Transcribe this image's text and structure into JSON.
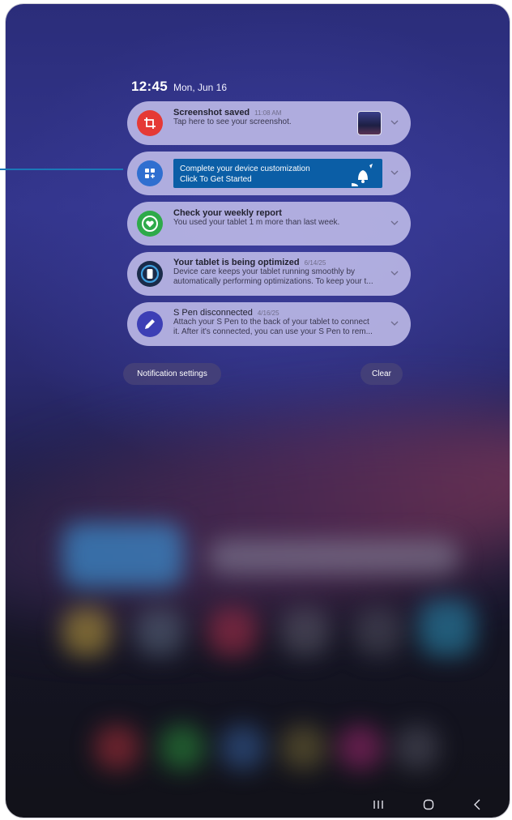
{
  "status": {
    "time": "12:45",
    "date": "Mon, Jun 16"
  },
  "notifications": [
    {
      "id": "screenshot",
      "title": "Screenshot saved",
      "time": "11:08 AM",
      "text": "Tap here to see your screenshot.",
      "icon": "screenshot-crop-icon",
      "icon_color": "#e53935"
    },
    {
      "id": "customization",
      "banner_line1": "Complete your device customization",
      "banner_line2": "Click To Get Started",
      "icon": "apps-add-icon",
      "icon_color": "#2f6fd0",
      "banner_color": "#0b5ea6"
    },
    {
      "id": "weekly",
      "title": "Check your weekly report",
      "time": "",
      "text": "You used your tablet 1 m more than last week.",
      "icon": "digital-wellbeing-heart-icon",
      "icon_color": "#2eaa4a"
    },
    {
      "id": "optimized",
      "title": "Your tablet is being optimized",
      "time": "6/14/25",
      "text1": "Device care keeps your tablet running smoothly by",
      "text2": "automatically performing optimizations. To keep your t...",
      "icon": "device-care-icon",
      "icon_color": "#1a2b4a"
    },
    {
      "id": "spen",
      "title": "S Pen disconnected",
      "time": "4/16/25",
      "text1": "Attach your S Pen to the back of your tablet to connect",
      "text2": "it. After it's connected, you can use your S Pen to rem...",
      "icon": "s-pen-icon",
      "icon_color": "#3d3fb5"
    }
  ],
  "actions": {
    "settings_label": "Notification settings",
    "clear_label": "Clear"
  },
  "navbar": {
    "recents": "recents-icon",
    "home": "home-icon",
    "back": "back-icon"
  }
}
